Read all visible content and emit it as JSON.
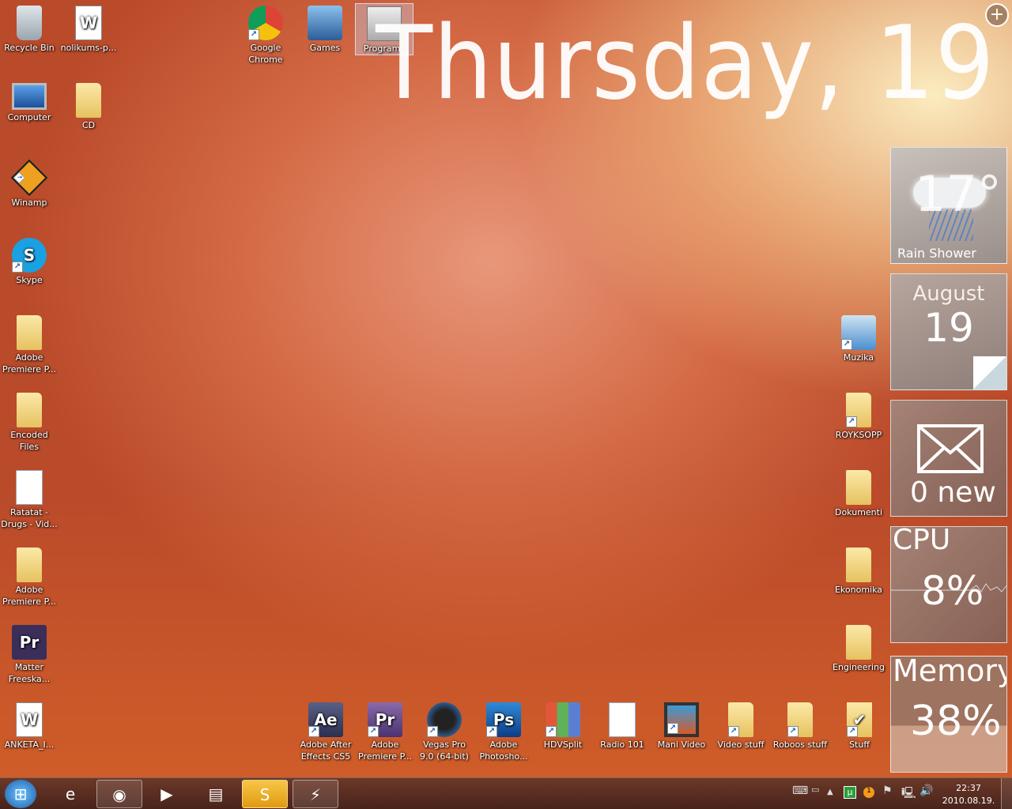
{
  "desktop": {
    "left": [
      {
        "label": "Recycle Bin",
        "icon": "recycle-bin-icon"
      },
      {
        "label": "Computer",
        "icon": "computer-icon"
      },
      {
        "label": "Winamp",
        "icon": "winamp-icon",
        "shortcut": true
      },
      {
        "label": "Skype",
        "icon": "skype-icon",
        "shortcut": true
      },
      {
        "label": "Adobe Premiere P...",
        "icon": "folder-icon"
      },
      {
        "label": "Encoded Files",
        "icon": "folder-icon"
      },
      {
        "label": "Ratatat - Drugs - Vid...",
        "icon": "winamp-file-icon"
      },
      {
        "label": "Adobe Premiere P...",
        "icon": "folder-icon"
      },
      {
        "label": "Matter Freeska...",
        "icon": "premiere-project-icon"
      },
      {
        "label": "ANKETA_I...",
        "icon": "word-document-icon"
      }
    ],
    "second": [
      {
        "label": "nolikums-p...",
        "icon": "word-document-icon"
      },
      {
        "label": "CD",
        "icon": "folder-icon"
      }
    ],
    "top": [
      {
        "label": "Google Chrome",
        "icon": "chrome-icon",
        "shortcut": true
      },
      {
        "label": "Games",
        "icon": "games-icon"
      },
      {
        "label": "Programs",
        "icon": "programs-folder-icon",
        "selected": true
      }
    ],
    "right": [
      {
        "label": "Muzika",
        "icon": "music-folder-icon",
        "shortcut": true
      },
      {
        "label": "ROYKSOPP",
        "icon": "folder-icon",
        "shortcut": true
      },
      {
        "label": "Dokumenti",
        "icon": "folder-icon"
      },
      {
        "label": "Ekonomika",
        "icon": "folder-icon"
      },
      {
        "label": "Engineering",
        "icon": "folder-icon"
      }
    ],
    "bottom": [
      {
        "label": "Adobe After Effects CS5",
        "icon": "after-effects-icon",
        "shortcut": true
      },
      {
        "label": "Adobe Premiere P...",
        "icon": "premiere-icon",
        "shortcut": true
      },
      {
        "label": "Vegas Pro 9.0 (64-bit)",
        "icon": "vegas-icon",
        "shortcut": true
      },
      {
        "label": "Adobe Photosho...",
        "icon": "photoshop-icon",
        "shortcut": true
      },
      {
        "label": "HDVSplit",
        "icon": "hdvsplit-icon",
        "shortcut": true
      },
      {
        "label": "Radio 101",
        "icon": "winamp-file-icon"
      },
      {
        "label": "Mani Video",
        "icon": "video-folder-icon",
        "shortcut": true
      },
      {
        "label": "Video stuff",
        "icon": "folder-icon",
        "shortcut": true
      },
      {
        "label": "Roboos stuff",
        "icon": "folder-icon",
        "shortcut": true
      },
      {
        "label": "Stuff",
        "icon": "folder-check-icon",
        "shortcut": true
      }
    ]
  },
  "clock_text": "Thursday, 19",
  "gadgets": {
    "weather": {
      "temp": "17°",
      "condition": "Rain Shower"
    },
    "calendar": {
      "month": "August",
      "day": "19"
    },
    "mail": {
      "count": "0 new"
    },
    "cpu": {
      "label": "CPU",
      "value": "8%"
    },
    "memory": {
      "label": "Memory",
      "value": "38%"
    }
  },
  "taskbar": {
    "buttons": [
      {
        "name": "start-button",
        "glyph": "⊞"
      },
      {
        "name": "internet-explorer",
        "glyph": "e"
      },
      {
        "name": "google-chrome",
        "glyph": "◉",
        "open": true
      },
      {
        "name": "media-player",
        "glyph": "▶"
      },
      {
        "name": "windows-explorer",
        "glyph": "▤"
      },
      {
        "name": "skype",
        "glyph": "S",
        "open": true
      },
      {
        "name": "winamp",
        "glyph": "⚡",
        "open": true
      }
    ],
    "time": "22:37",
    "date": "2010.08.19."
  },
  "colors": {
    "accent": "#e07a3a"
  }
}
